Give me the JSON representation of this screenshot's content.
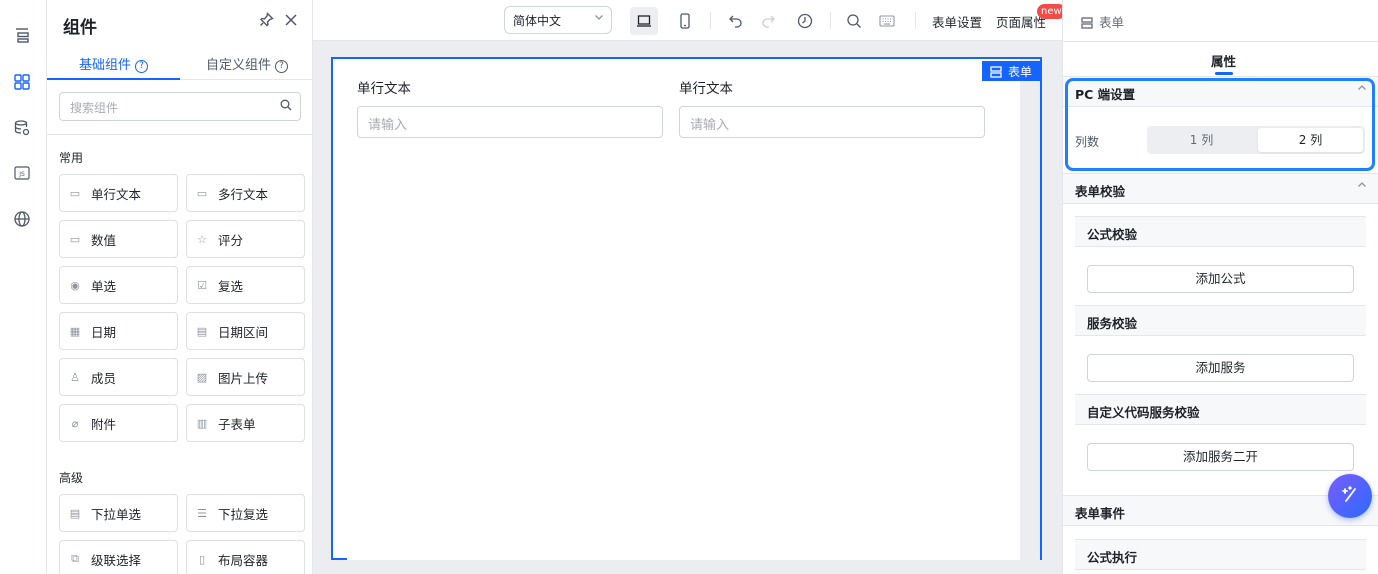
{
  "left_panel": {
    "title": "组件",
    "tabs": [
      "基础组件",
      "自定义组件"
    ],
    "search_placeholder": "搜索组件",
    "section_common": "常用",
    "section_advanced": "高级",
    "common_items": [
      {
        "label": "单行文本",
        "icon": "single-line-text-icon"
      },
      {
        "label": "多行文本",
        "icon": "multi-line-text-icon"
      },
      {
        "label": "数值",
        "icon": "number-icon"
      },
      {
        "label": "评分",
        "icon": "star-icon"
      },
      {
        "label": "单选",
        "icon": "radio-icon"
      },
      {
        "label": "复选",
        "icon": "checkbox-icon"
      },
      {
        "label": "日期",
        "icon": "calendar-icon"
      },
      {
        "label": "日期区间",
        "icon": "date-range-icon"
      },
      {
        "label": "成员",
        "icon": "member-icon"
      },
      {
        "label": "图片上传",
        "icon": "image-upload-icon"
      },
      {
        "label": "附件",
        "icon": "attachment-icon"
      },
      {
        "label": "子表单",
        "icon": "subform-icon"
      }
    ],
    "advanced_items": [
      {
        "label": "下拉单选",
        "icon": "dropdown-single-icon"
      },
      {
        "label": "下拉复选",
        "icon": "dropdown-multi-icon"
      },
      {
        "label": "级联选择",
        "icon": "cascader-icon"
      },
      {
        "label": "布局容器",
        "icon": "layout-container-icon"
      }
    ]
  },
  "toolbar": {
    "language": "简体中文",
    "form_settings": "表单设置",
    "page_properties": "页面属性",
    "new_badge": "new"
  },
  "canvas": {
    "form_badge": "表单",
    "fields": [
      {
        "label": "单行文本",
        "placeholder": "请输入"
      },
      {
        "label": "单行文本",
        "placeholder": "请输入"
      }
    ]
  },
  "right_panel": {
    "header": "表单",
    "tab": "属性",
    "pc_settings": "PC 端设置",
    "columns_label": "列数",
    "column_options": [
      "1 列",
      "2 列"
    ],
    "selected_columns": "2 列",
    "form_validation": "表单校验",
    "formula_validation": "公式校验",
    "add_formula": "添加公式",
    "service_validation": "服务校验",
    "add_service": "添加服务",
    "custom_code_validation": "自定义代码服务校验",
    "add_service_dev": "添加服务二开",
    "form_events": "表单事件",
    "formula_execution": "公式执行"
  },
  "colors": {
    "accent": "#1664ff",
    "highlight": "#1e80ff",
    "badge": "#f54a45"
  }
}
